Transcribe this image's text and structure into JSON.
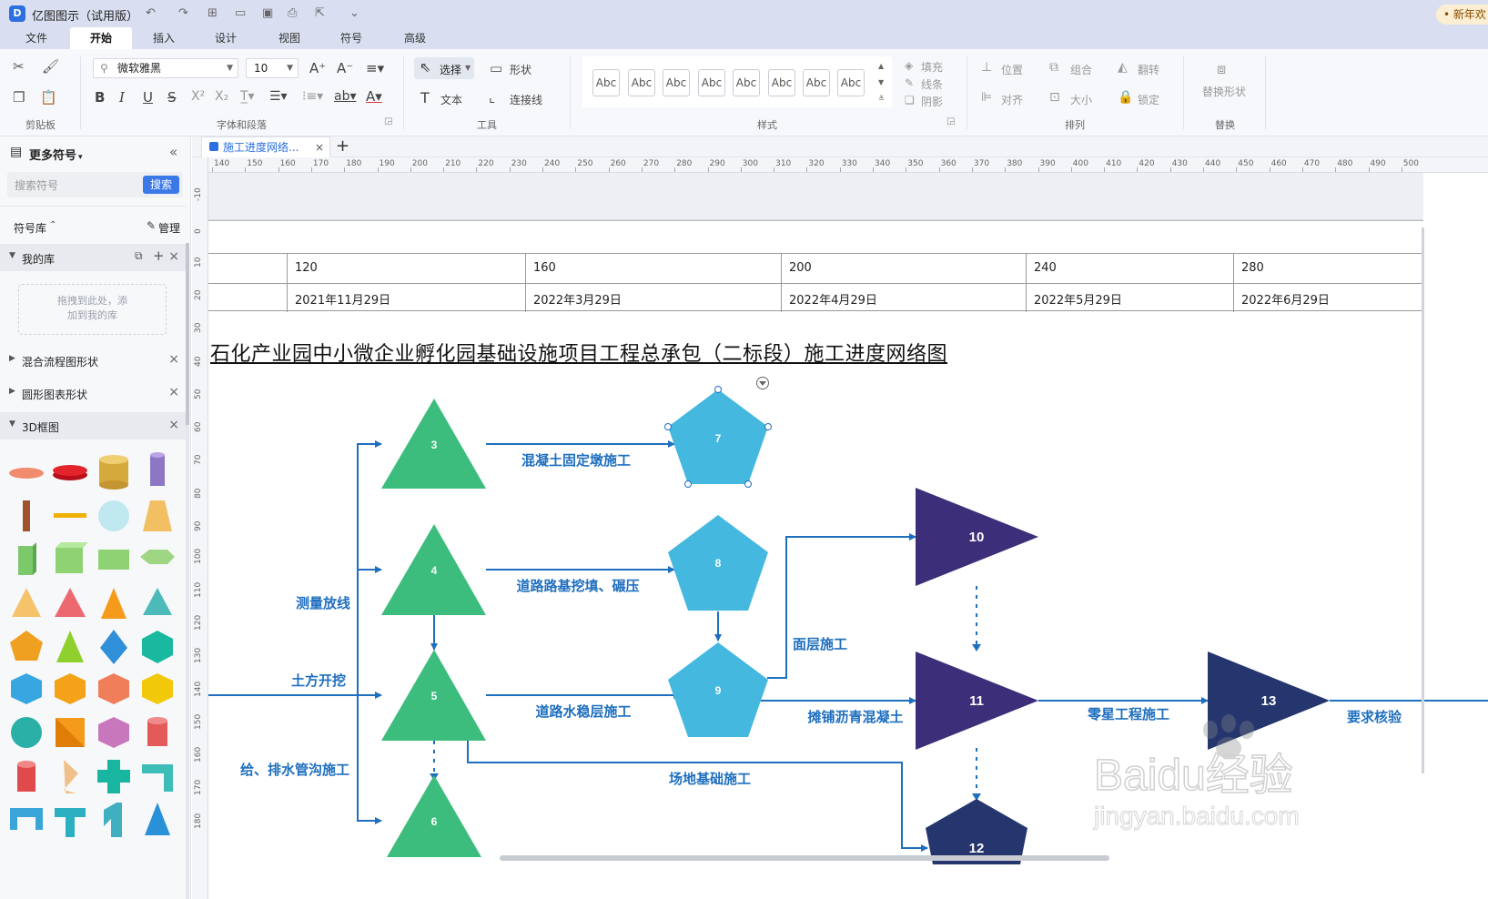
{
  "app": {
    "logo_letter": "D",
    "title": "亿图图示（试用版）",
    "promo": "• 新年欢"
  },
  "menu": {
    "tabs": [
      "文件",
      "开始",
      "插入",
      "设计",
      "视图",
      "符号",
      "高级"
    ],
    "active": "开始"
  },
  "ribbon": {
    "clipboard_label": "剪贴板",
    "font_name": "微软雅黑",
    "font_size": "10",
    "font_group_label": "字体和段落",
    "select_label": "选择",
    "shape_label": "形状",
    "text_label": "文本",
    "connector_label": "连接线",
    "tools_label": "工具",
    "style_samples": [
      "Abc",
      "Abc",
      "Abc",
      "Abc",
      "Abc",
      "Abc",
      "Abc",
      "Abc"
    ],
    "fill_label": "填充",
    "line_label": "线条",
    "shadow_label": "阴影",
    "style_label": "样式",
    "position_label": "位置",
    "group_label": "组合",
    "flip_label": "翻转",
    "align_label": "对齐",
    "size_label": "大小",
    "lock_label": "锁定",
    "arrange_label": "排列",
    "replace_shape_label": "替换形状",
    "replace_label": "替换"
  },
  "left_panel": {
    "title": "更多符号",
    "search_placeholder": "搜索符号",
    "search_button": "搜索",
    "library_label": "符号库",
    "manage_label": "管理",
    "my_library": "我的库",
    "drop_hint_line1": "拖拽到此处，添",
    "drop_hint_line2": "加到我的库",
    "categories": [
      "混合流程图形状",
      "圆形图表形状",
      "3D框图"
    ]
  },
  "document": {
    "tab_title": "施工进度网络...",
    "ruler_top": [
      "140",
      "150",
      "160",
      "170",
      "180",
      "190",
      "200",
      "210",
      "220",
      "230",
      "240",
      "250",
      "260",
      "270",
      "280",
      "290",
      "300",
      "310",
      "320",
      "330",
      "340",
      "350",
      "360",
      "370",
      "380",
      "390",
      "400",
      "410",
      "420",
      "430",
      "440",
      "450",
      "460",
      "470",
      "480",
      "490",
      "500"
    ],
    "ruler_left": [
      "-10",
      "0",
      "10",
      "20",
      "30",
      "40",
      "50",
      "60",
      "70",
      "80",
      "90",
      "100",
      "110",
      "120",
      "130",
      "140",
      "150",
      "160",
      "170",
      "180"
    ]
  },
  "timeline": {
    "days": [
      "120",
      "160",
      "200",
      "240",
      "280"
    ],
    "dates": [
      "2021年11月29日",
      "2022年3月29日",
      "2022年4月29日",
      "2022年5月29日",
      "2022年6月29日"
    ]
  },
  "diagram": {
    "title": "石化产业园中小微企业孵化园基础设施项目工程总承包（二标段）施工进度网络图",
    "nodes": [
      "3",
      "4",
      "5",
      "6",
      "7",
      "8",
      "9",
      "10",
      "11",
      "12",
      "13"
    ],
    "activities": {
      "a_3_7": "混凝土固定墩施工",
      "a_4_8": "道路路基挖填、碾压",
      "a_measure": "测量放线",
      "a_earth": "土方开挖",
      "a_5_9": "道路水稳层施工",
      "a_water": "给、排水管沟施工",
      "a_site": "场地基础施工",
      "a_surface": "面层施工",
      "a_asphalt": "摊铺沥青混凝土",
      "a_misc": "零星工程施工",
      "a_check": "要求核验"
    },
    "colors": {
      "triangle_green": "#3dbd7d",
      "pentagon_blue": "#45b8e0",
      "triangle_purple": "#3d2e7a",
      "navy": "#25366e",
      "arrow": "#1f6fbf",
      "label": "#1f6fbf"
    }
  },
  "watermark": {
    "brand": "Baidu经验",
    "url": "jingyan.baidu.com"
  }
}
